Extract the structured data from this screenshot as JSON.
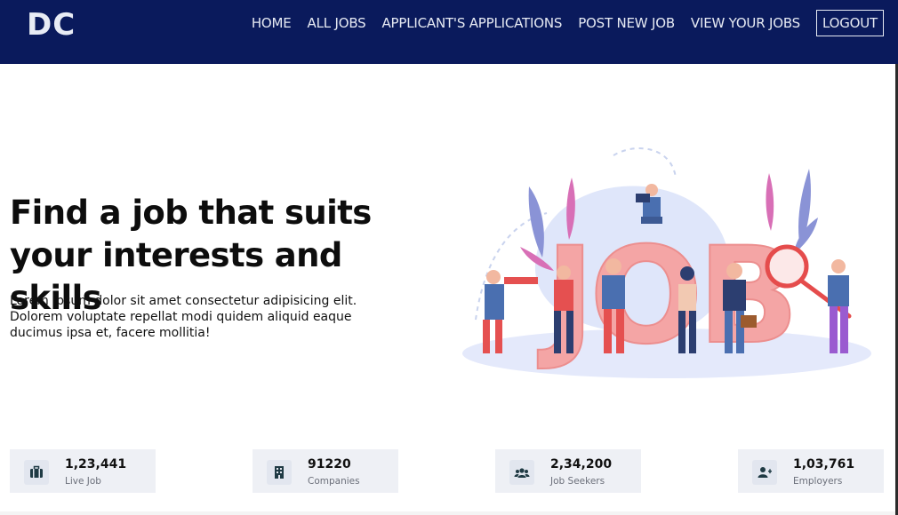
{
  "header": {
    "logo": "DC",
    "nav": [
      "HOME",
      "ALL JOBS",
      "APPLICANT'S APPLICATIONS",
      "POST NEW JOB",
      "VIEW YOUR JOBS"
    ],
    "logout": "LOGOUT"
  },
  "hero": {
    "title_line1": "Find a job that suits",
    "title_line2": "your interests and skills",
    "description": "Lorem ipsum dolor sit amet consectetur adipisicing elit. Dolorem voluptate repellat modi quidem aliquid eaque ducimus ipsa et, facere mollitia!",
    "illustration_word": "JOB"
  },
  "stats": [
    {
      "value": "1,23,441",
      "label": "Live Job",
      "icon": "briefcase-icon"
    },
    {
      "value": "91220",
      "label": "Companies",
      "icon": "building-icon"
    },
    {
      "value": "2,34,200",
      "label": "Job Seekers",
      "icon": "users-icon"
    },
    {
      "value": "1,03,761",
      "label": "Employers",
      "icon": "user-plus-icon"
    }
  ],
  "colors": {
    "navbar": "#0a1a5c",
    "nav_text": "#e6eaf3",
    "stat_card": "#eef0f5",
    "icon_fill": "#1f3a44",
    "job_letters": "#f4a5a5"
  }
}
